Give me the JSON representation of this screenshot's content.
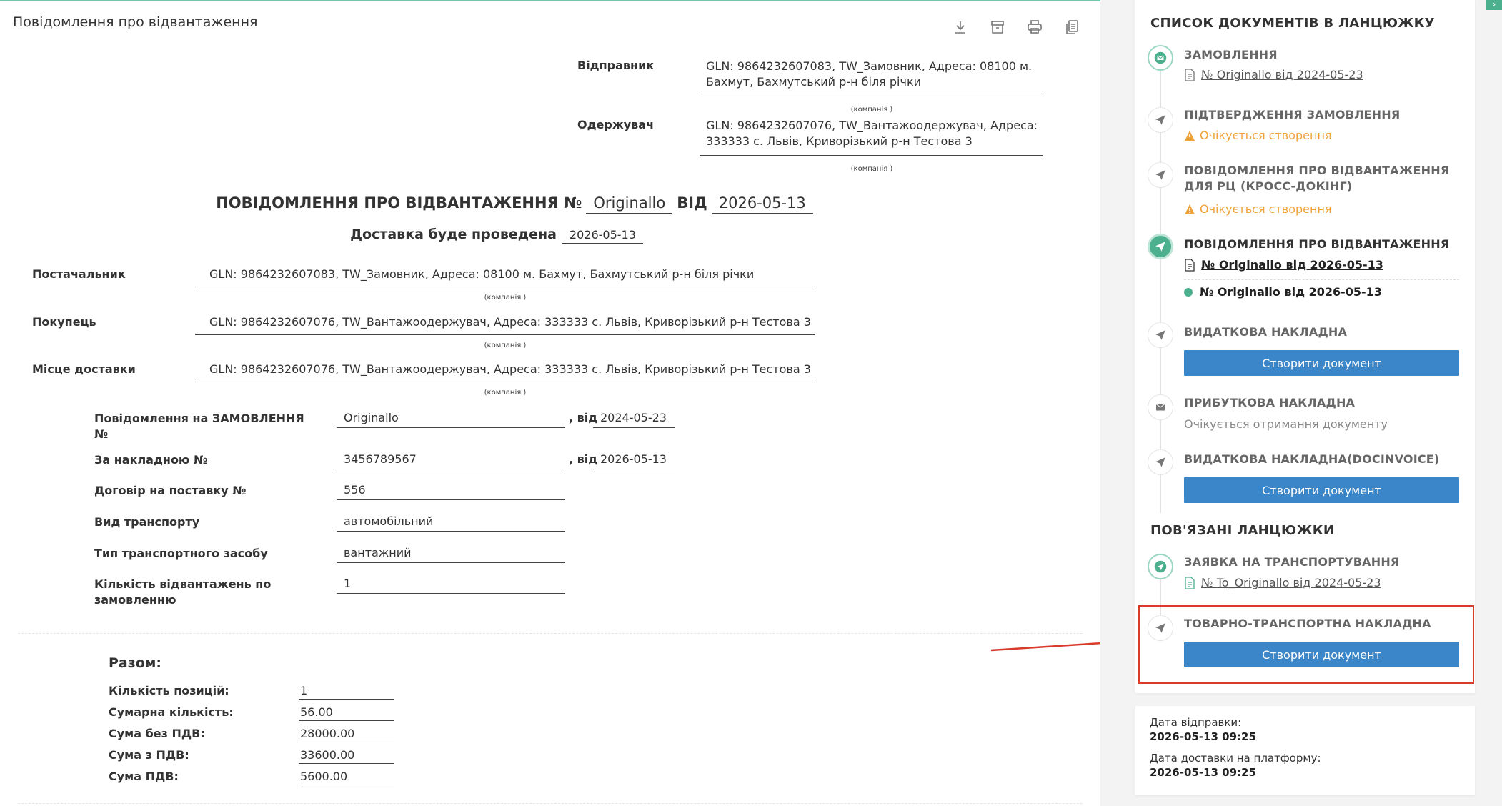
{
  "page": {
    "title": "Повідомлення про відвантаження"
  },
  "sender": {
    "label": "Відправник",
    "value": "GLN: 9864232607083, TW_Замовник, Адреса: 08100 м. Бахмут, Бахмутський р-н біля річки",
    "caption": "(компанія )"
  },
  "receiver": {
    "label": "Одержувач",
    "value": "GLN: 9864232607076, TW_Вантажоодержувач, Адреса: 333333 с. Львів, Криворізький р-н Тестова 3",
    "caption": "(компанія )"
  },
  "heading": {
    "prefix": "ПОВІДОМЛЕННЯ ПРО ВІДВАНТАЖЕННЯ №",
    "number": "Originallo",
    "from_label": "ВІД",
    "date": "2026-05-13",
    "delivery_label": "Доставка буде проведена",
    "delivery_date": "2026-05-13"
  },
  "parties": [
    {
      "label": "Постачальник",
      "value": "GLN: 9864232607083, TW_Замовник, Адреса: 08100 м. Бахмут, Бахмутський р-н біля річки",
      "caption": "(компанія )"
    },
    {
      "label": "Покупець",
      "value": "GLN: 9864232607076, TW_Вантажоодержувач, Адреса: 333333 с. Львів, Криворізький р-н Тестова 3",
      "caption": "(компанія )"
    },
    {
      "label": "Місце доставки",
      "value": "GLN: 9864232607076, TW_Вантажоодержувач, Адреса: 333333 с. Львів, Криворізький р-н Тестова 3",
      "caption": "(компанія )"
    }
  ],
  "fields": {
    "order": {
      "label": "Повідомлення на ЗАМОВЛЕННЯ №",
      "value": "Originallo",
      "sep": ", від",
      "date": "2024-05-23"
    },
    "invoice": {
      "label": "За накладною №",
      "value": "3456789567",
      "sep": ", від",
      "date": "2026-05-13"
    },
    "contract": {
      "label": "Договір на поставку №",
      "value": "556"
    },
    "transport": {
      "label": "Вид транспорту",
      "value": "автомобільний"
    },
    "vehicle": {
      "label": "Тип транспортного засобу",
      "value": "вантажний"
    },
    "shipments": {
      "label": "Кількість відвантажень по замовленню",
      "value": "1"
    }
  },
  "totals": {
    "title": "Разом:",
    "rows": [
      {
        "label": "Кількість позицій:",
        "value": "1"
      },
      {
        "label": "Сумарна кількість:",
        "value": "56.00"
      },
      {
        "label": "Сума без ПДВ:",
        "value": "28000.00"
      },
      {
        "label": "Сума з ПДВ:",
        "value": "33600.00"
      },
      {
        "label": "Сума ПДВ:",
        "value": "5600.00"
      }
    ]
  },
  "chain": {
    "title": "СПИСОК ДОКУМЕНТІВ В ЛАНЦЮЖКУ",
    "order": {
      "title": "ЗАМОВЛЕННЯ",
      "link": "№ Originallo від 2024-05-23"
    },
    "confirm": {
      "title": "ПІДТВЕРДЖЕННЯ ЗАМОВЛЕННЯ",
      "status": "Очікується створення"
    },
    "crossdock": {
      "title": "ПОВІДОМЛЕННЯ ПРО ВІДВАНТАЖЕННЯ ДЛЯ РЦ (КРОСС-ДОКІНГ)",
      "status": "Очікується створення"
    },
    "desadv": {
      "title": "ПОВІДОМЛЕННЯ ПРО ВІДВАНТАЖЕННЯ",
      "link": "№ Originallo від 2026-05-13",
      "current": "№ Originallo від 2026-05-13"
    },
    "expense": {
      "title": "ВИДАТКОВА НАКЛАДНА",
      "button": "Створити документ"
    },
    "income": {
      "title": "ПРИБУТКОВА НАКЛАДНА",
      "status": "Очікується отримання документу"
    },
    "docinvoice": {
      "title": "ВИДАТКОВА НАКЛАДНА(DOCINVOICE)",
      "button": "Створити документ"
    }
  },
  "related": {
    "title": "ПОВ'ЯЗАНІ ЛАНЦЮЖКИ",
    "transport": {
      "title": "ЗАЯВКА НА ТРАНСПОРТУВАННЯ",
      "link": "№ To_Originallo від 2024-05-23"
    },
    "ttn": {
      "title": "ТОВАРНО-ТРАНСПОРТНА НАКЛАДНА",
      "button": "Створити документ"
    }
  },
  "dates": {
    "sent_label": "Дата відправки:",
    "sent_value": "2026-05-13 09:25",
    "delivered_label": "Дата доставки на платформу:",
    "delivered_value": "2026-05-13 09:25"
  },
  "colors": {
    "accent": "#4caf8e",
    "button": "#3a86c8",
    "warning": "#f0a23a",
    "highlight": "#d93a2b"
  },
  "icons": [
    "download-icon",
    "archive-icon",
    "print-icon",
    "copy-icon",
    "envelope-icon",
    "send-icon",
    "document-icon",
    "warning-icon",
    "chevron-right-icon"
  ]
}
